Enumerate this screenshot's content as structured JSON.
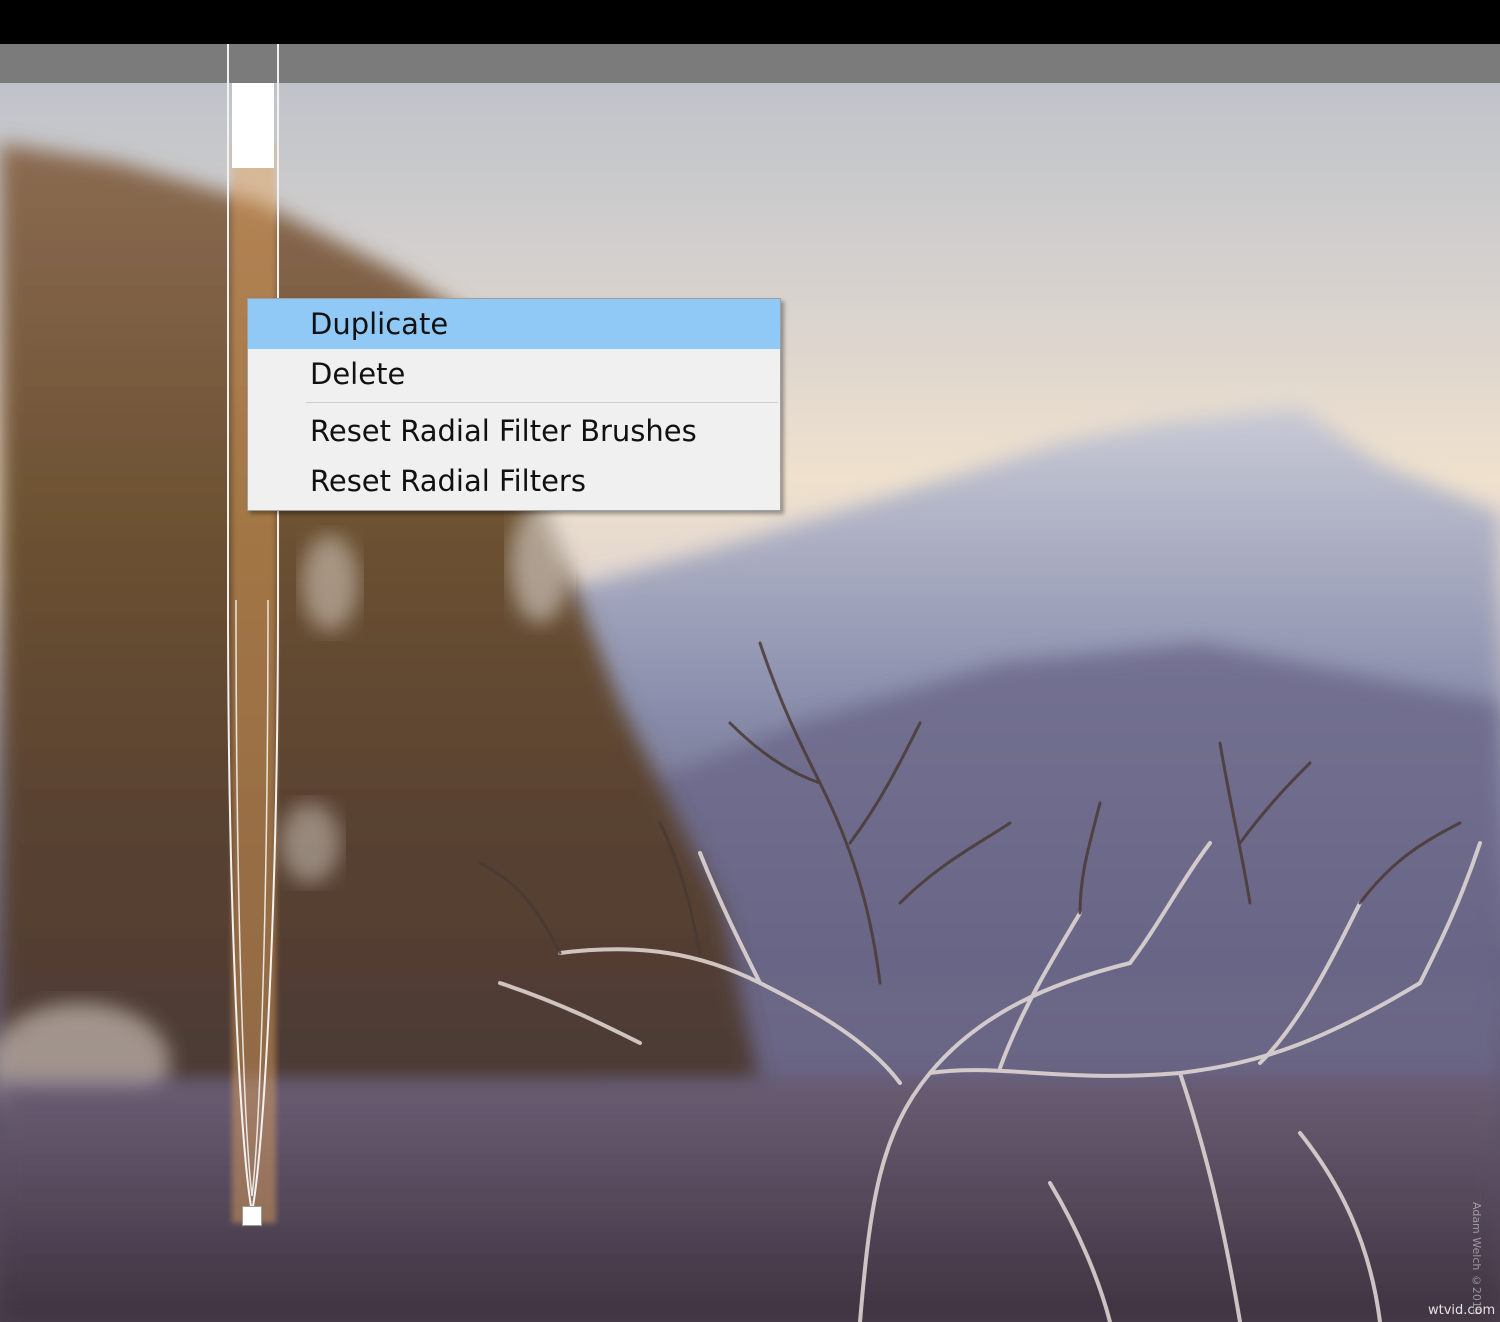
{
  "context_menu": {
    "items": [
      {
        "label": "Duplicate",
        "active": true
      },
      {
        "label": "Delete"
      },
      {
        "label": "Reset Radial Filter Brushes"
      },
      {
        "label": "Reset Radial Filters"
      }
    ]
  },
  "watermark": "Adam Welch ©2019",
  "site_mark": "wtvid.com",
  "colors": {
    "menu_background": "#f0f0f0",
    "menu_highlight": "#90c8f6",
    "top_bar": "#000000",
    "gray_strip": "#7b7b7b"
  }
}
